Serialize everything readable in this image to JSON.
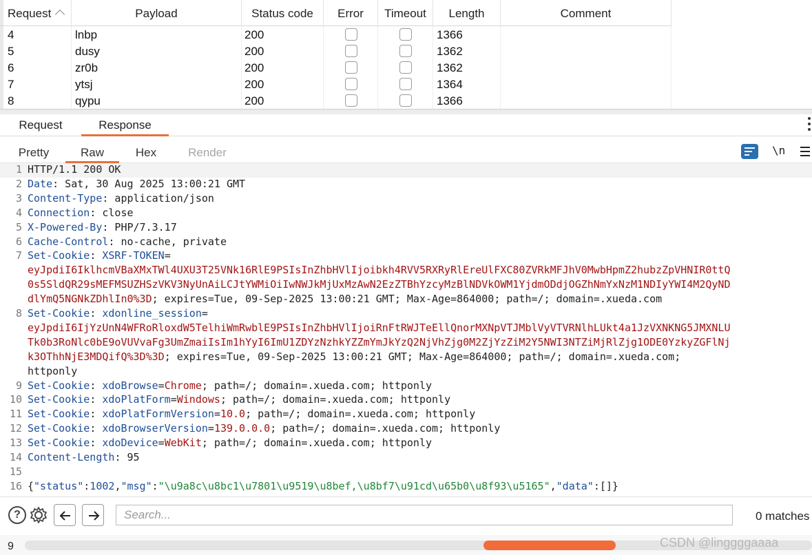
{
  "table": {
    "columns": [
      "Request",
      "Payload",
      "Status code",
      "Error",
      "Timeout",
      "Length",
      "Comment"
    ],
    "rows": [
      {
        "request": "4",
        "payload": "lnbp",
        "status": "200",
        "error": false,
        "timeout": false,
        "length": "1366",
        "comment": ""
      },
      {
        "request": "5",
        "payload": "dusy",
        "status": "200",
        "error": false,
        "timeout": false,
        "length": "1362",
        "comment": ""
      },
      {
        "request": "6",
        "payload": "zr0b",
        "status": "200",
        "error": false,
        "timeout": false,
        "length": "1362",
        "comment": ""
      },
      {
        "request": "7",
        "payload": "ytsj",
        "status": "200",
        "error": false,
        "timeout": false,
        "length": "1364",
        "comment": ""
      },
      {
        "request": "8",
        "payload": "qypu",
        "status": "200",
        "error": false,
        "timeout": false,
        "length": "1366",
        "comment": ""
      }
    ]
  },
  "tabs": {
    "main": [
      "Request",
      "Response"
    ],
    "main_active": "Response",
    "sub": [
      "Pretty",
      "Raw",
      "Hex",
      "Render"
    ],
    "sub_active": "Raw",
    "sub_disabled": "Render",
    "newline_toggle": "\\n"
  },
  "response": {
    "lines": [
      {
        "n": "1",
        "text": "HTTP/1.1 200 OK"
      },
      {
        "n": "2",
        "name": "Date",
        "value": " Sat, 30 Aug 2025 13:00:21 GMT"
      },
      {
        "n": "3",
        "name": "Content-Type",
        "value": " application/json"
      },
      {
        "n": "4",
        "name": "Connection",
        "value": " close"
      },
      {
        "n": "5",
        "name": "X-Powered-By",
        "value": " PHP/7.3.17"
      },
      {
        "n": "6",
        "name": "Cache-Control",
        "value": " no-cache, private"
      },
      {
        "n": "7",
        "name": "Set-Cookie",
        "cookie": "XSRF-TOKEN",
        "cval": [
          "eyJpdiI6IklhcmVBaXMxTWl4UXU3T25VNk16RlE9PSIsInZhbHVlIjoibkh4RVV5RXRyRlEreUlFXC80ZVRkMFJhV0MwbHpmZ2hubzZpVHNIR0ttQ",
          "0s5SldQR29sMEFMSUZHSzVKV3NyUnAiLCJtYWMiOiIwNWJkMjUxMzAwN2EzZTBhYzcyMzBlNDVkOWM1YjdmODdjOGZhNmYxNzM1NDIyYWI4M2QyND",
          "dlYmQ5NGNkZDhlIn0%3D"
        ],
        "rest": "; expires=Tue, 09-Sep-2025 13:00:21 GMT; Max-Age=864000; path=/; domain=.xueda.com"
      },
      {
        "n": "8",
        "name": "Set-Cookie",
        "cookie": "xdonline_session",
        "cval": [
          "eyJpdiI6IjYzUnN4WFRoRloxdW5TelhiWmRwblE9PSIsInZhbHVlIjoiRnFtRWJTeEllQnorMXNpVTJMblVyVTVRNlhLUkt4a1JzVXNKNG5JMXNLU",
          "Tk0b3RoNlc0bE9oVUVvaFg3UmZmaiIsIm1hYyI6ImU1ZDYzNzhkYZZmYmJkYzQ2NjVhZjg0M2ZjYzZiM2Y5NWI3NTZiMjRlZjg1ODE0YzkyZGFlNj",
          "k3OThhNjE3MDQifQ%3D%3D"
        ],
        "rest": "; expires=Tue, 09-Sep-2025 13:00:21 GMT; Max-Age=864000; path=/; domain=.xueda.com;",
        "cont": "httponly"
      },
      {
        "n": "9",
        "name": "Set-Cookie",
        "cookie": "xdoBrowse",
        "cval": [
          "Chrome"
        ],
        "rest": "; path=/; domain=.xueda.com; httponly"
      },
      {
        "n": "10",
        "name": "Set-Cookie",
        "cookie": "xdoPlatForm",
        "cval": [
          "Windows"
        ],
        "rest": "; path=/; domain=.xueda.com; httponly"
      },
      {
        "n": "11",
        "name": "Set-Cookie",
        "cookie": "xdoPlatFormVersion",
        "cval": [
          "10.0"
        ],
        "rest": "; path=/; domain=.xueda.com; httponly"
      },
      {
        "n": "12",
        "name": "Set-Cookie",
        "cookie": "xdoBrowserVersion",
        "cval": [
          "139.0.0.0"
        ],
        "rest": "; path=/; domain=.xueda.com; httponly"
      },
      {
        "n": "13",
        "name": "Set-Cookie",
        "cookie": "xdoDevice",
        "cval": [
          "WebKit"
        ],
        "rest": "; path=/; domain=.xueda.com; httponly"
      },
      {
        "n": "14",
        "name": "Content-Length",
        "value": " 95"
      },
      {
        "n": "15",
        "text": ""
      },
      {
        "n": "16",
        "json": true
      }
    ],
    "body_json": {
      "open": "{",
      "k1": "\"status\"",
      "colon1": ":",
      "v1": "1002",
      "comma1": ",",
      "k2": "\"msg\"",
      "colon2": ":",
      "v2": "\"\\u9a8c\\u8bc1\\u7801\\u9519\\u8bef,\\u8bf7\\u91cd\\u65b0\\u8f93\\u5165\"",
      "comma2": ",",
      "k3": "\"data\"",
      "colon3": ":",
      "v3": "[]",
      "close": "}"
    }
  },
  "search": {
    "placeholder": "Search...",
    "matches": "0 matches",
    "help_label": "?"
  },
  "footer": {
    "row_number": "9",
    "watermark": "CSDN @linggggaaaa"
  },
  "colors": {
    "accent": "#e8703a",
    "header_name": "#1f4e97",
    "cookie_value": "#a31515",
    "json_string": "#22863a"
  },
  "icons": [
    "sort-ascending-icon",
    "wrap-lines-icon",
    "menu-icon",
    "help-icon",
    "gear-icon",
    "arrow-left-icon",
    "arrow-right-icon",
    "vertical-dots-icon"
  ]
}
